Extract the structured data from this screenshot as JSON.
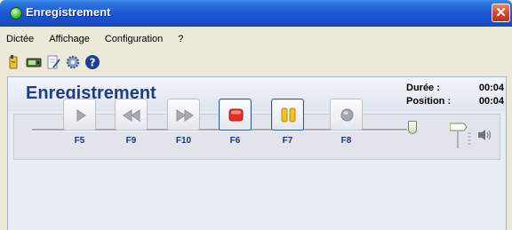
{
  "window": {
    "title": "Enregistrement",
    "close_glyph": "✕"
  },
  "menu": {
    "items": [
      "Dictée",
      "Affichage",
      "Configuration",
      "?"
    ]
  },
  "toolbar": {
    "icons": [
      "dictation-icon",
      "recorder-icon",
      "document-pen-icon",
      "settings-gear-icon",
      "help-icon"
    ]
  },
  "panel": {
    "title": "Enregistrement",
    "duration_label": "Durée :",
    "duration_value": "00:04",
    "position_label": "Position :",
    "position_value": "00:04",
    "progress_fraction": 1.0
  },
  "transport": {
    "buttons": [
      {
        "key": "play",
        "shortcut": "F5",
        "active": false
      },
      {
        "key": "rewind",
        "shortcut": "F9",
        "active": false
      },
      {
        "key": "fast-forward",
        "shortcut": "F10",
        "active": false
      },
      {
        "key": "stop",
        "shortcut": "F6",
        "active": true
      },
      {
        "key": "pause",
        "shortcut": "F7",
        "active": true
      },
      {
        "key": "record",
        "shortcut": "F8",
        "active": false
      }
    ]
  },
  "colors": {
    "title_blue": "#1f3d83",
    "stop_red": "#e0302a",
    "pause_yellow": "#f2c21f"
  }
}
